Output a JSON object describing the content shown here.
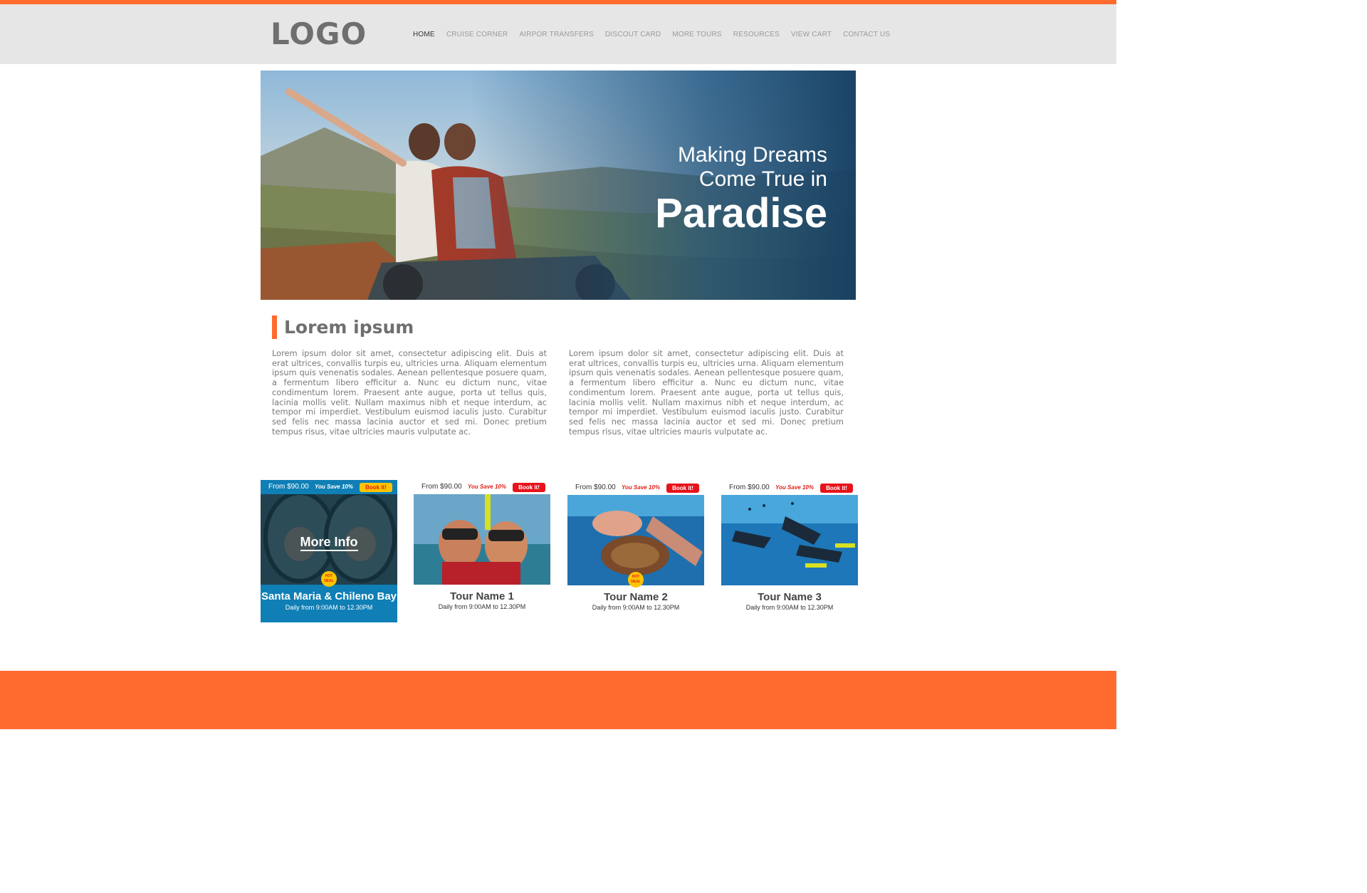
{
  "header": {
    "logo": "LOGO",
    "nav": [
      "HOME",
      "CRUISE CORNER",
      "AIRPOR TRANSFERS",
      "DISCOUT CARD",
      "MORE TOURS",
      "RESOURCES",
      "VIEW CART",
      "CONTACT US"
    ],
    "active_index": 0
  },
  "hero": {
    "line1": "Making Dreams",
    "line2": "Come True in",
    "line3": "Paradise"
  },
  "intro": {
    "title": "Lorem ipsum",
    "paragraph_left": "Lorem ipsum dolor sit amet, consectetur adipiscing elit. Duis at erat ultrices, convallis turpis eu, ultricies urna. Aliquam elementum ipsum quis venenatis sodales. Aenean pellentesque posuere quam, a fermentum libero efficitur a. Nunc eu dictum nunc, vitae condimentum lorem. Praesent ante augue, porta ut tellus quis, lacinia mollis velit. Nullam maximus nibh et neque interdum, ac tempor mi imperdiet. Vestibulum euismod iaculis justo. Curabitur sed felis nec massa lacinia auctor et sed mi. Donec pretium tempus risus, vitae ultricies mauris vulputate ac.",
    "paragraph_right": "Lorem ipsum dolor sit amet, consectetur adipiscing elit. Duis at erat ultrices, convallis turpis eu, ultricies urna. Aliquam elementum ipsum quis venenatis sodales. Aenean pellentesque posuere quam, a fermentum libero efficitur a. Nunc eu dictum nunc, vitae condimentum lorem. Praesent ante augue, porta ut tellus quis, lacinia mollis velit. Nullam maximus nibh et neque interdum, ac tempor mi imperdiet. Vestibulum euismod iaculis justo. Curabitur sed felis nec massa lacinia auctor et sed mi. Donec pretium tempus risus, vitae ultricies mauris vulputate ac."
  },
  "tours": [
    {
      "price": "From $90.00",
      "save": "You Save 10%",
      "book": "Book it!",
      "name": "Santa Maria & Chileno Bay",
      "schedule": "Daily from 9:00AM to 12.30PM",
      "hot": "HOT DEAL",
      "more_info": "More Info"
    },
    {
      "price": "From $90.00",
      "save": "You Save 10%",
      "book": "Book it!",
      "name": "Tour Name 1",
      "schedule": "Daily from 9:00AM to 12.30PM"
    },
    {
      "price": "From $90.00",
      "save": "You Save 10%",
      "book": "Book it!",
      "name": "Tour Name 2",
      "schedule": "Daily from 9:00AM to 12.30PM",
      "hot": "HOT DEAL"
    },
    {
      "price": "From $90.00",
      "save": "You Save 10%",
      "book": "Book it!",
      "name": "Tour Name 3",
      "schedule": "Daily from 9:00AM to 12.30PM"
    }
  ],
  "colors": {
    "accent": "#ff6b2e",
    "header_bg": "#e6e6e6",
    "book_red": "#e8121b",
    "featured_blue": "#0f7fb5",
    "hot_yellow": "#ffc400"
  }
}
